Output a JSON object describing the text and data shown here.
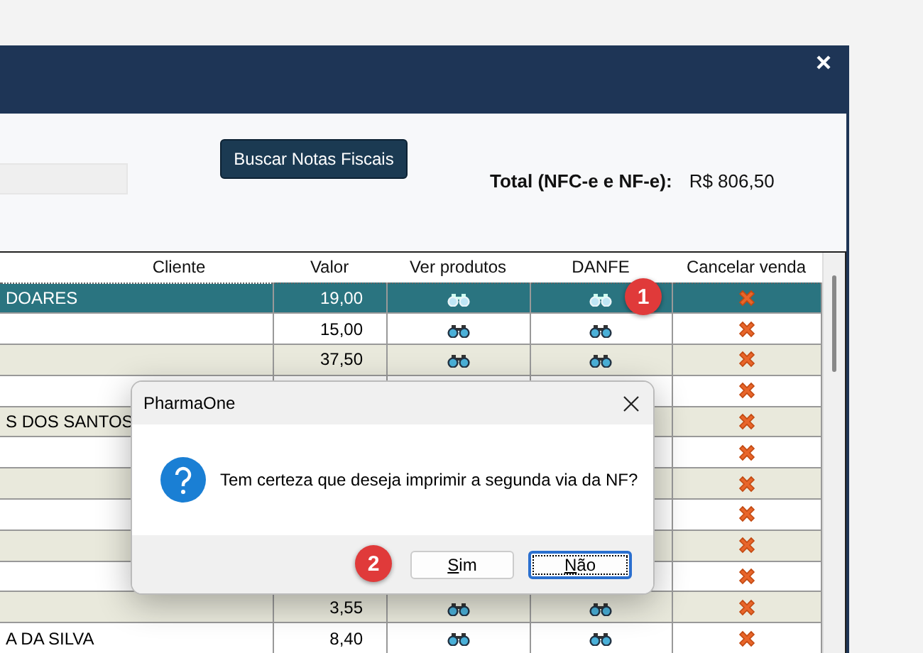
{
  "window": {
    "search_button": "Buscar Notas Fiscais",
    "total_label": "Total (NFC-e e NF-e):",
    "total_value": "R$ 806,50"
  },
  "table": {
    "columns": [
      "Cliente",
      "Valor",
      "Ver produtos",
      "DANFE",
      "Cancelar venda"
    ],
    "rows": [
      {
        "cliente": "DOARES",
        "valor": "19,00",
        "kind": "full",
        "selected": true
      },
      {
        "valor": "15,00",
        "kind": "full",
        "selected": false
      },
      {
        "valor": "37,50",
        "kind": "full",
        "selected": false
      },
      {
        "kind": "covered",
        "selected": false
      },
      {
        "cliente": "S DOS SANTOS",
        "kind": "covered",
        "selected": false
      },
      {
        "kind": "covered",
        "selected": false
      },
      {
        "kind": "covered",
        "selected": false
      },
      {
        "kind": "covered",
        "selected": false
      },
      {
        "kind": "covered",
        "selected": false
      },
      {
        "kind": "covered",
        "selected": false
      },
      {
        "valor": "3,55",
        "kind": "full",
        "selected": false
      },
      {
        "cliente": "A DA SILVA",
        "valor": "8,40",
        "kind": "full",
        "selected": false
      }
    ]
  },
  "dialog": {
    "title": "PharmaOne",
    "message": "Tem certeza que deseja imprimir a segunda via da NF?",
    "buttons": [
      {
        "label": "Sim",
        "focused": false
      },
      {
        "label": "Não",
        "focused": true
      }
    ]
  },
  "annotations": [
    {
      "label": "1"
    },
    {
      "label": "2"
    }
  ]
}
